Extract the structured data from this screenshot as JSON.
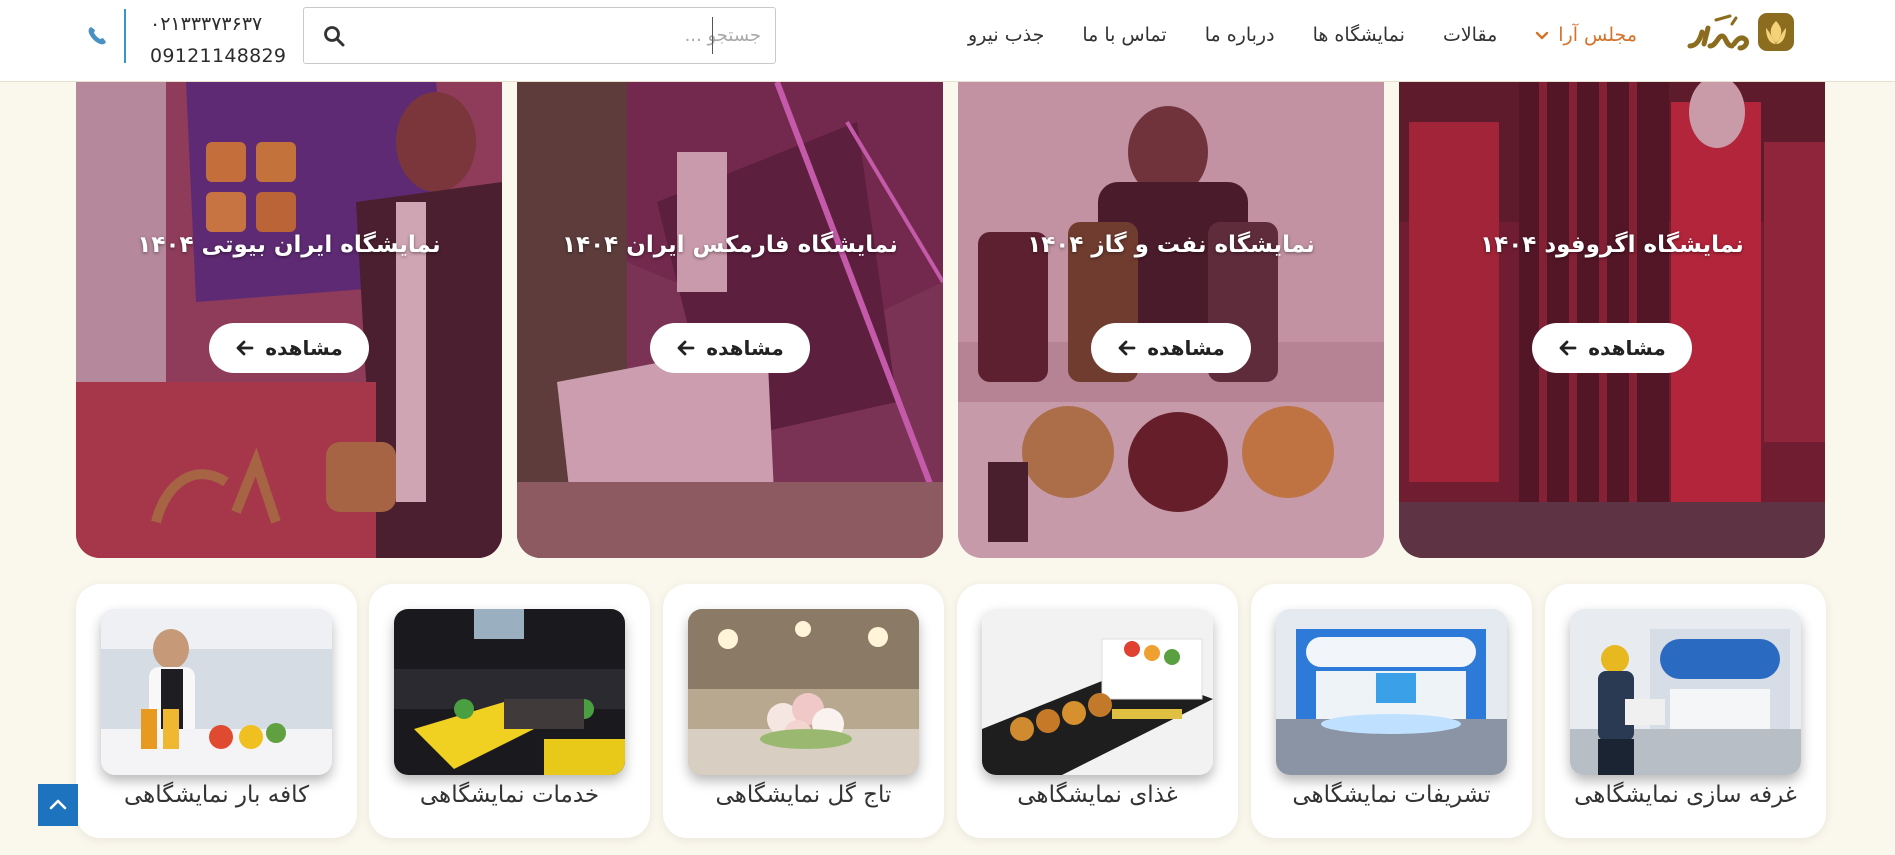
{
  "header": {
    "logo_text": "مجلس آرا",
    "nav": [
      {
        "label": "مجلس آرا",
        "active": true,
        "has_dropdown": true
      },
      {
        "label": "مقالات"
      },
      {
        "label": "نمایشگاه ها"
      },
      {
        "label": "درباره ما"
      },
      {
        "label": "تماس با ما"
      },
      {
        "label": "جذب نیرو"
      }
    ],
    "search": {
      "placeholder": "جستجو ...",
      "value": "",
      "icon": "search-icon"
    },
    "phones": [
      "۰۲۱۳۳۳۷۳۶۳۷",
      "09121148829"
    ],
    "phone_icon": "phone-icon",
    "accent_color": "#d4732a",
    "phone_accent": "#3a93c9"
  },
  "exhibitions": [
    {
      "title": "نمایشگاه اگروفود ۱۴۰۴",
      "button": "مشاهده"
    },
    {
      "title": "نمایشگاه نفت و گاز ۱۴۰۴",
      "button": "مشاهده"
    },
    {
      "title": "نمایشگاه فارمکس ایران ۱۴۰۴",
      "button": "مشاهده"
    },
    {
      "title": "نمایشگاه ایران بیوتی ۱۴۰۴",
      "button": "مشاهده"
    }
  ],
  "services": [
    {
      "label": "غرفه سازی نمایشگاهی"
    },
    {
      "label": "تشریفات نمایشگاهی"
    },
    {
      "label": "غذای نمایشگاهی"
    },
    {
      "label": "تاج گل نمایشگاهی"
    },
    {
      "label": "خدمات نمایشگاهی"
    },
    {
      "label": "کافه بار نمایشگاهی"
    }
  ],
  "scroll_top_icon": "chevron-up-icon",
  "scroll_top_color": "#1e73be"
}
